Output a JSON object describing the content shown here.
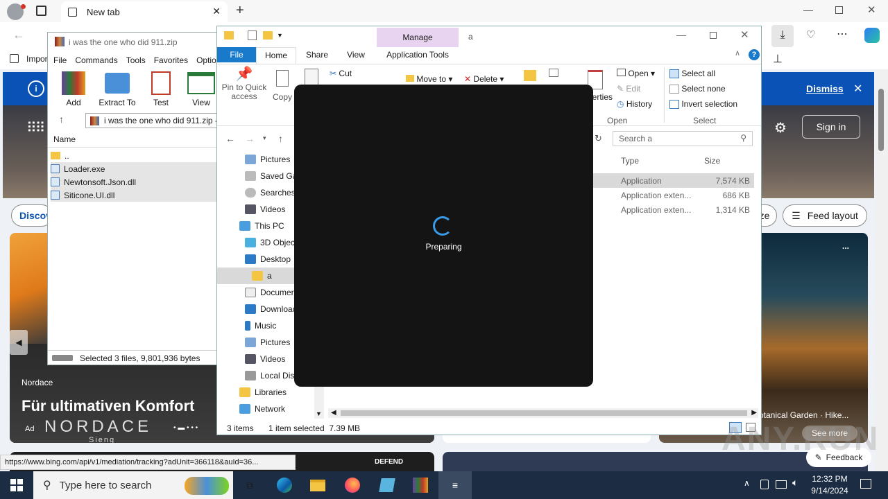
{
  "browser": {
    "tab_title": "New tab",
    "bookmark_first": "Impor",
    "banner_dismiss": "Dismiss",
    "sign_in": "Sign in",
    "discover": "Discov",
    "feed_layout": "Feed layout",
    "ze": "ze",
    "status_url": "https://www.bing.com/api/v1/mediation/tracking?adUnit=366118&auId=36...",
    "ad_brand": "Nordace",
    "ad_title": "Für ultimativen Komfort",
    "ad_logo": "NORDACE",
    "ad_label": "Ad",
    "ad_sub": "Sieng",
    "card_caption": "otanical Garden · Hike...",
    "see_more": "See more",
    "feedback": "Feedback",
    "defend": "DEFEND",
    "ellipsis": "..."
  },
  "winrar": {
    "title": "i was the one who did 911.zip",
    "menu": [
      "File",
      "Commands",
      "Tools",
      "Favorites",
      "Optio"
    ],
    "buttons": [
      "Add",
      "Extract To",
      "Test",
      "View"
    ],
    "path": "i was the one who did 911.zip -",
    "col_name": "Name",
    "files": [
      "..",
      "Loader.exe",
      "Newtonsoft.Json.dll",
      "Siticone.UI.dll"
    ],
    "status": "Selected 3 files, 9,801,936 bytes"
  },
  "explorer": {
    "manage": "Manage",
    "title": "a",
    "tabs": [
      "File",
      "Home",
      "Share",
      "View",
      "Application Tools"
    ],
    "ribbon": {
      "pin": "Pin to Quick access",
      "copy": "Copy",
      "cut": "Cut",
      "move_to": "Move to",
      "delete": "Delete",
      "properties": "erties",
      "open": "Open",
      "edit": "Edit",
      "history": "History",
      "open_group": "Open",
      "select_all": "Select all",
      "select_none": "Select none",
      "invert": "Invert selection",
      "select_group": "Select"
    },
    "search_placeholder": "Search a",
    "nav": [
      "Pictures",
      "Saved Gar",
      "Searches",
      "Videos",
      "This PC",
      "3D Object",
      "Desktop",
      "a",
      "Documer",
      "Download",
      "Music",
      "Pictures",
      "Videos",
      "Local Disk",
      "Libraries",
      "Network"
    ],
    "col_type": "Type",
    "col_size": "Size",
    "rows": [
      {
        "type": "Application",
        "size": "7,574 KB"
      },
      {
        "type": "Application exten...",
        "size": "686 KB"
      },
      {
        "type": "Application exten...",
        "size": "1,314 KB"
      }
    ],
    "status_items": "3 items",
    "status_selected": "1 item selected  7.39 MB"
  },
  "dialog": {
    "text": "Preparing"
  },
  "taskbar": {
    "search": "Type here to search",
    "time": "12:32 PM",
    "date": "9/14/2024"
  },
  "watermark": "ANY.RUN"
}
